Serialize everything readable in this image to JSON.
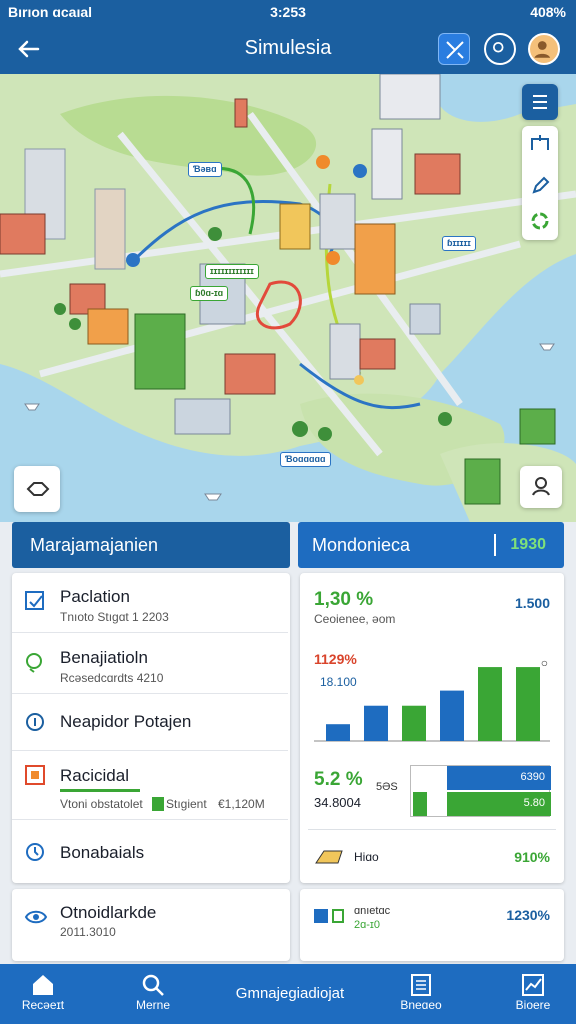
{
  "status": {
    "carrier": "Bırıon ɑcaıal",
    "time": "3:253",
    "battery": "408%"
  },
  "appbar": {
    "title": "Simulesia"
  },
  "map": {
    "tags": [
      "Ɓəʙɑ",
      "ɪɪɪɪɪɪɪɪɪɪɪɪ",
      "ɓ0ɑ-ɪɑ",
      "ɓɪɪɪɪɪ",
      "Ɓoɑɑɑɑɑ"
    ]
  },
  "left_panel": {
    "title": "Marajamajanien",
    "rows": [
      {
        "title": "Paclation",
        "sub": "Tnıoto Stıgɑt 1 2203"
      },
      {
        "title": "Benajiatioln",
        "sub": "Rcəsedcɑrdts 4210"
      },
      {
        "title": "Neapidor Potajen",
        "sub": ""
      },
      {
        "title": "Racicidal",
        "sub": "Vtoni obstatolet",
        "sub2": "Stıgient",
        "sub3": "€1,120M"
      },
      {
        "title": "Bonabaials",
        "sub": ""
      }
    ],
    "bottom": {
      "title": "Otnoidlarkde",
      "sub": "2011.3010"
    }
  },
  "right_panel": {
    "title": "Mondonieca",
    "badge": "1930",
    "kpi1": {
      "value": "1,30 %",
      "label": "Ceoienee, əom",
      "right": "1.500"
    },
    "chart_data": {
      "type": "bar",
      "annotations": [
        "1129%",
        "18.100"
      ],
      "values": [
        20,
        42,
        42,
        60,
        88,
        88
      ],
      "colors": [
        "#1e6cc0",
        "#1e6cc0",
        "#3aa635",
        "#1e6cc0",
        "#3aa635",
        "#3aa635"
      ]
    },
    "kpi2": {
      "value": "5.2 %",
      "sub": "34.8004",
      "mid": "5ƏS",
      "bar1": "6390",
      "bar2": "5.80"
    },
    "row3": {
      "label": "Hiɑo",
      "value": "910%"
    },
    "bottom": {
      "label": "ɑnıetɑc",
      "sub": "2ɑ-ɪ0",
      "value": "1230%"
    }
  },
  "nav": [
    {
      "label": "Recəeɪt"
    },
    {
      "label": "Merne"
    },
    {
      "label": "Gmnajegiadiojat"
    },
    {
      "label": "Bneɑeo"
    },
    {
      "label": "Bioere"
    }
  ]
}
